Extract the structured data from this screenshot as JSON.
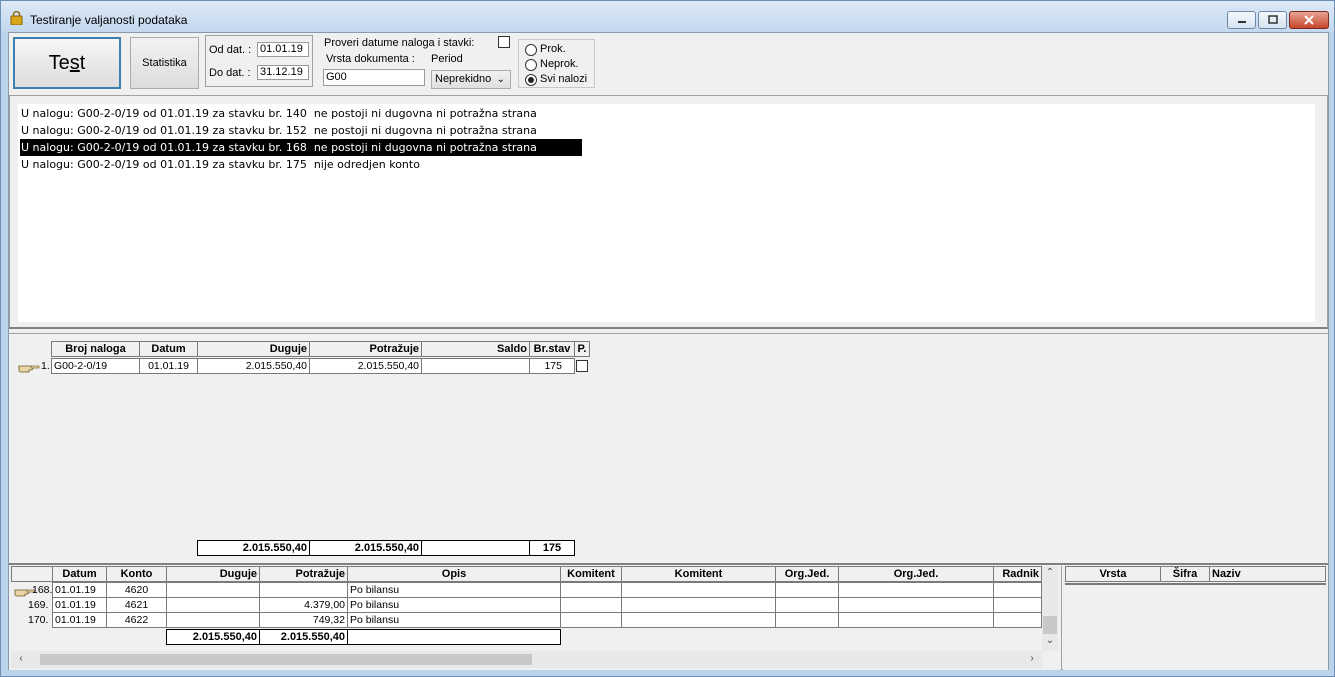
{
  "window": {
    "title": "Testiranje valjanosti podataka",
    "minimize_icon": "minimize-icon",
    "maximize_icon": "maximize-icon",
    "close_icon": "close-icon"
  },
  "toolbar": {
    "test_label_pre": "Te",
    "test_label_accel": "s",
    "test_label_post": "t",
    "stat_label": "Statistika",
    "od_label": "Od dat. :",
    "od_value": "01.01.19",
    "do_label": "Do dat. :",
    "do_value": "31.12.19",
    "check_label": "Proveri datume naloga i stavki:",
    "check_checked": false,
    "vrsta_label": "Vrsta dokumenta :",
    "vrsta_value": "G00",
    "period_label": "Period",
    "period_value": "Neprekidno",
    "radios": [
      {
        "label": "Prok.",
        "checked": false
      },
      {
        "label": "Neprok.",
        "checked": false
      },
      {
        "label": "Svi nalozi",
        "checked": true
      }
    ]
  },
  "messages": [
    "U nalogu: G00-2-0/19 od 01.01.19 za stavku br. 140  ne postoji ni dugovna ni potražna strana",
    "U nalogu: G00-2-0/19 od 01.01.19 za stavku br. 152  ne postoji ni dugovna ni potražna strana",
    "U nalogu: G00-2-0/19 od 01.01.19 za stavku br. 168  ne postoji ni dugovna ni potražna strana",
    "U nalogu: G00-2-0/19 od 01.01.19 za stavku br. 175  nije odredjen konto"
  ],
  "selected_message_index": 2,
  "nalozi": {
    "headers": {
      "broj": "Broj naloga",
      "datum": "Datum",
      "duguje": "Duguje",
      "potrazuje": "Potražuje",
      "saldo": "Saldo",
      "brstav": "Br.stav",
      "p": "P."
    },
    "rows": [
      {
        "rownum": "1.",
        "broj": "G00-2-0/19",
        "datum": "01.01.19",
        "duguje": "2.015.550,40",
        "potrazuje": "2.015.550,40",
        "saldo": "",
        "brstav": "175",
        "p": false
      }
    ],
    "totals": {
      "duguje": "2.015.550,40",
      "potrazuje": "2.015.550,40",
      "saldo": "",
      "brstav": "175"
    }
  },
  "stavke": {
    "headers": {
      "datum": "Datum",
      "konto": "Konto",
      "duguje": "Duguje",
      "potrazuje": "Potražuje",
      "opis": "Opis",
      "komitent1": "Komitent",
      "komitent2": "Komitent",
      "orgjed1": "Org.Jed.",
      "orgjed2": "Org.Jed.",
      "radnik": "Radnik"
    },
    "rows": [
      {
        "rownum": "168.",
        "datum": "01.01.19",
        "konto": "4620",
        "duguje": "",
        "potrazuje": "",
        "opis": "Po bilansu"
      },
      {
        "rownum": "169.",
        "datum": "01.01.19",
        "konto": "4621",
        "duguje": "",
        "potrazuje": "4.379,00",
        "opis": "Po bilansu"
      },
      {
        "rownum": "170.",
        "datum": "01.01.19",
        "konto": "4622",
        "duguje": "",
        "potrazuje": "749,32",
        "opis": "Po bilansu"
      }
    ],
    "totals": {
      "duguje": "2.015.550,40",
      "potrazuje": "2.015.550,40",
      "opis": ""
    }
  },
  "right_grid": {
    "headers": {
      "vrsta": "Vrsta",
      "sifra": "Šifra",
      "naziv": "Naziv"
    }
  }
}
